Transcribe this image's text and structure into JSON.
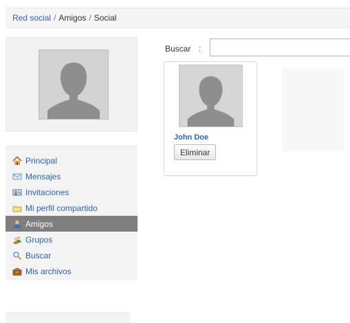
{
  "breadcrumb": {
    "root": "Red social",
    "separator": "/",
    "section": "Amigos",
    "current": "Social"
  },
  "menu": {
    "items": [
      {
        "label": "Principal",
        "icon": "home-icon",
        "active": false
      },
      {
        "label": "Mensajes",
        "icon": "envelope-icon",
        "active": false
      },
      {
        "label": "Invitaciones",
        "icon": "invitation-icon",
        "active": false
      },
      {
        "label": "Mi perfil compartido",
        "icon": "folder-icon",
        "active": false
      },
      {
        "label": "Amigos",
        "icon": "user-icon",
        "active": true
      },
      {
        "label": "Grupos",
        "icon": "group-icon",
        "active": false
      },
      {
        "label": "Buscar",
        "icon": "search-icon",
        "active": false
      },
      {
        "label": "Mis archivos",
        "icon": "briefcase-icon",
        "active": false
      }
    ]
  },
  "search": {
    "label": "Buscar",
    "colon": ":",
    "value": ""
  },
  "friends": [
    {
      "name": "John Doe",
      "action_label": "Eliminar"
    }
  ],
  "colors": {
    "link": "#2a63b6",
    "active_menu_bg": "#7e7e7e",
    "panel_bg": "#f3f3f3"
  }
}
